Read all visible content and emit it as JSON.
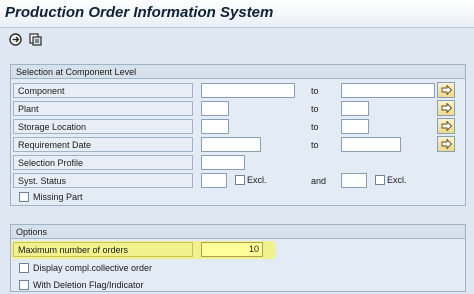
{
  "window": {
    "title": "Production Order Information System"
  },
  "toolbar": {
    "icons": [
      "execute-icon",
      "variant-icon"
    ]
  },
  "selection": {
    "group_title": "Selection at Component Level",
    "to_label": "to",
    "and_label": "and",
    "excl_label": "Excl.",
    "rows": [
      {
        "label": "Component",
        "from": "",
        "to": ""
      },
      {
        "label": "Plant",
        "from": "",
        "to": ""
      },
      {
        "label": "Storage Location",
        "from": "",
        "to": ""
      },
      {
        "label": "Requirement Date",
        "from": "",
        "to": ""
      },
      {
        "label": "Selection Profile",
        "value": ""
      },
      {
        "label": "Syst. Status",
        "from": "",
        "to": ""
      }
    ],
    "missing_part": {
      "label": "Missing Part",
      "checked": false
    }
  },
  "options": {
    "group_title": "Options",
    "max_orders": {
      "label": "Maximum number of orders",
      "value": "10"
    },
    "display_collective": {
      "label": "Display compl.collective order",
      "checked": false
    },
    "deletion_flag": {
      "label": "With Deletion Flag/Indicator",
      "checked": false
    }
  },
  "colors": {
    "background": "#dfe8f2",
    "highlight": "#f3f37a",
    "input_highlight": "#ffff9a"
  }
}
